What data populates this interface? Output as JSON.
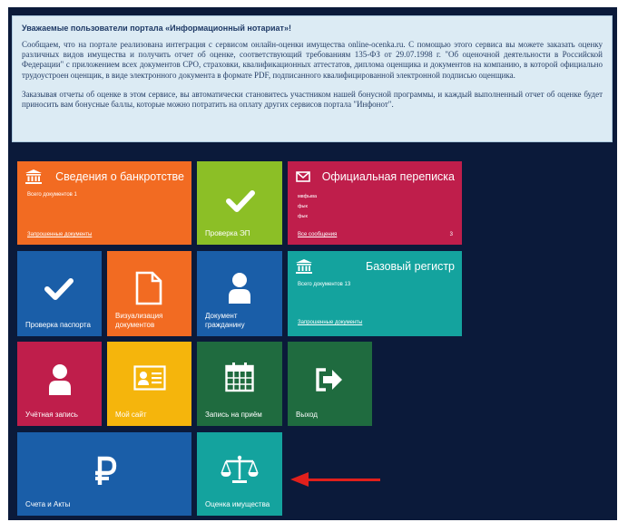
{
  "notice": {
    "title": "Уважаемые пользователи портала «Информационный нотариат»!",
    "paragraph1": "Сообщаем, что на портале реализована интеграция с сервисом онлайн-оценки имущества online-ocenka.ru. С помощью этого сервиса вы можете заказать оценку различных видов имущества и получить отчет об оценке, соответствующий требованиям 135-ФЗ от 29.07.1998 г. \"Об оценочной деятельности в Российской Федерации\" с приложением всех документов СРО, страховки, квалификационных аттестатов, диплома оценщика и документов на компанию, в которой официально трудоустроен оценщик, в виде электронного документа в формате PDF, подписанного квалифицированной электронной подписью оценщика.",
    "paragraph2": "Заказывая отчеты об оценке в этом сервисе, вы автоматически становитесь участником нашей бонусной программы, и каждый выполненный отчет об оценке будет приносить вам бонусные баллы, которые можно потратить на оплату других сервисов портала \"Инфонот\"."
  },
  "tiles": {
    "bankruptcy": {
      "title": "Сведения о банкротстве",
      "subtitle": "Всего документов 1",
      "link": "Запрошенные документы",
      "color": "#f26b22",
      "icon": "bank-icon"
    },
    "ep_check": {
      "label": "Проверка ЭП",
      "color": "#8cbf26",
      "icon": "checkmark-icon"
    },
    "correspondence": {
      "title": "Официальная переписка",
      "messages": [
        "мвфыва",
        "фык",
        "фык"
      ],
      "link": "Все сообщения",
      "count": "3",
      "color": "#bf1e4b",
      "icon": "envelope-icon"
    },
    "passport": {
      "label": "Проверка паспорта",
      "color": "#1a5ea8",
      "icon": "checkmark-icon"
    },
    "visualization": {
      "label": "Визуализация документов",
      "color": "#f26b22",
      "icon": "document-icon"
    },
    "citizen_doc": {
      "label": "Документ гражданину",
      "color": "#1a5ea8",
      "icon": "user-icon"
    },
    "base_registry": {
      "title": "Базовый регистр",
      "subtitle": "Всего документов 13",
      "link": "Запрошенные документы",
      "color": "#14a39e",
      "icon": "bank-icon"
    },
    "account": {
      "label": "Учётная запись",
      "color": "#bf1e4b",
      "icon": "user-icon"
    },
    "my_site": {
      "label": "Мой сайт",
      "color": "#f5b50c",
      "icon": "id-card-icon"
    },
    "appointment": {
      "label": "Запись на приём",
      "color": "#1f6b3f",
      "icon": "calendar-icon"
    },
    "logout": {
      "label": "Выход",
      "color": "#1f6b3f",
      "icon": "exit-icon"
    },
    "invoices": {
      "label": "Счета и Акты",
      "color": "#1a5ea8",
      "icon": "ruble-icon"
    },
    "appraisal": {
      "label": "Оценка имущества",
      "color": "#14a39e",
      "icon": "scales-icon"
    }
  },
  "annotation": {
    "color": "#e0201c",
    "icon": "left-arrow-icon"
  }
}
